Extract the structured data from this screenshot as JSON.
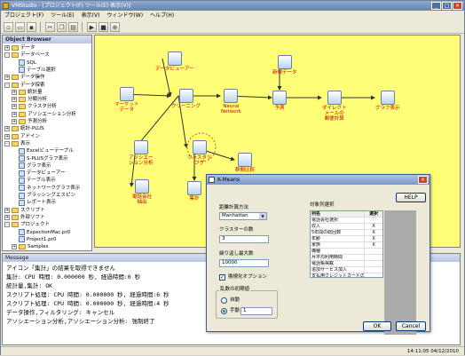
{
  "window": {
    "title": "VMStudio - [プロジェクト(F) ツール(E) 表示(V)]"
  },
  "menu": [
    "プロジェクト(F)",
    "ツール(E)",
    "表示(V)",
    "ウィンドウ(W)",
    "ヘルプ(H)"
  ],
  "toolbar": {
    "icons": [
      "new-icon",
      "open-icon",
      "save-icon",
      "cut-icon",
      "copy-icon",
      "paste-icon",
      "run-icon",
      "stop-icon",
      "zoom-icon"
    ]
  },
  "object_browser": {
    "title": "Object Browser",
    "items": [
      {
        "label": "データ",
        "level": 0,
        "expand": "+"
      },
      {
        "label": "データベース",
        "level": 0,
        "expand": "-"
      },
      {
        "label": "SQL",
        "level": 1,
        "expand": ""
      },
      {
        "label": "テーブル選択",
        "level": 1,
        "expand": ""
      },
      {
        "label": "データ操作",
        "level": 0,
        "expand": "+"
      },
      {
        "label": "データ探索",
        "level": 0,
        "expand": "-"
      },
      {
        "label": "統計量",
        "level": 1,
        "expand": "+"
      },
      {
        "label": "分類分析",
        "level": 1,
        "expand": "+"
      },
      {
        "label": "クラスタ分析",
        "level": 1,
        "expand": "+"
      },
      {
        "label": "アソシエーション分析",
        "level": 1,
        "expand": "+"
      },
      {
        "label": "予測分析",
        "level": 1,
        "expand": "+"
      },
      {
        "label": "統計-PLUS",
        "level": 0,
        "expand": "+"
      },
      {
        "label": "アドイン",
        "level": 0,
        "expand": "+"
      },
      {
        "label": "表示",
        "level": 0,
        "expand": "-"
      },
      {
        "label": "Excelビューテーブル",
        "level": 1,
        "expand": ""
      },
      {
        "label": "S-PLUSグラフ表示",
        "level": 1,
        "expand": ""
      },
      {
        "label": "グラフ表示",
        "level": 1,
        "expand": ""
      },
      {
        "label": "データビューアー",
        "level": 1,
        "expand": ""
      },
      {
        "label": "テーブル表示",
        "level": 1,
        "expand": ""
      },
      {
        "label": "ネットワークグラフ表示",
        "level": 1,
        "expand": ""
      },
      {
        "label": "ブラッシングエスピン",
        "level": 1,
        "expand": ""
      },
      {
        "label": "レポート表示",
        "level": 1,
        "expand": ""
      },
      {
        "label": "スクリプト",
        "level": 0,
        "expand": "+"
      },
      {
        "label": "外部ソフト",
        "level": 0,
        "expand": "+"
      },
      {
        "label": "プロジェクト",
        "level": 0,
        "expand": "-"
      },
      {
        "label": "ExpectionMac.pr0",
        "level": 1,
        "expand": ""
      },
      {
        "label": "Project1.pr0",
        "level": 1,
        "expand": ""
      },
      {
        "label": "Samples",
        "level": 1,
        "expand": "+"
      }
    ]
  },
  "canvas": {
    "background": "#ffff77",
    "label_color": "#c00000",
    "nodes": [
      {
        "id": "n-dataviewer",
        "label": "データビューアー"
      },
      {
        "id": "n-market",
        "label": "マーケット\nデータ"
      },
      {
        "id": "n-cleaning",
        "label": "クリーニング"
      },
      {
        "id": "n-neural",
        "label": "Neural\nNetwork"
      },
      {
        "id": "n-newdata",
        "label": "新規データ"
      },
      {
        "id": "n-predict",
        "label": "予測"
      },
      {
        "id": "n-direct",
        "label": "ダイレクト\nメールの\n郵便計算"
      },
      {
        "id": "n-graph",
        "label": "グラフ表示"
      },
      {
        "id": "n-assoc",
        "label": "アソシエー\nション分析"
      },
      {
        "id": "n-cluster",
        "label": "クラスタリ\nング"
      },
      {
        "id": "n-groupcmp",
        "label": "群間比較"
      },
      {
        "id": "n-phone",
        "label": "電話会社\n抽出"
      },
      {
        "id": "n-sum",
        "label": "集計"
      }
    ]
  },
  "messages": {
    "title": "Message",
    "lines": [
      "アイコン「集計」の結果を取得できません",
      "集計: CPU 時間: 0.000000 秒, 経過時間:0 秒",
      "統計量,集計: OK",
      "スクリプト処理: CPU 時間: 0.000000 秒, 経過時間:6 秒",
      "スクリプト処理: CPU 時間: 0.000000 秒, 経過時間:4 秒",
      "データ操作,フィルタリング: キャンセル",
      "アソシエーション分析,アソシエーション分析: 強制終了"
    ]
  },
  "status": {
    "text": "14:11:05  04/12/2010"
  },
  "dialog": {
    "title": "K-Means",
    "help_label": "HELP",
    "distance_label": "距離計算方法",
    "distance_value": "Manhattan",
    "clusters_label": "クラスターの数",
    "clusters_value": "3",
    "iterations_label": "繰り返し最大数",
    "iterations_value": "10000",
    "option_label": "換規化オプション",
    "option_checked": true,
    "init_group_label": "乱数の初期値",
    "auto_label": "自動",
    "manual_label": "手動",
    "manual_value": "1",
    "vars_label": "対象列選択",
    "vars_header": [
      "列名",
      "選択"
    ],
    "vars": [
      {
        "name": "電話会社選択",
        "sel": ""
      },
      {
        "name": "収入",
        "sel": "X"
      },
      {
        "name": "5年間の総回数",
        "sel": "X"
      },
      {
        "name": "年齢",
        "sel": "X"
      },
      {
        "name": "家族",
        "sel": "X"
      },
      {
        "name": "職種",
        "sel": ""
      },
      {
        "name": "月平均利用時間",
        "sel": ""
      },
      {
        "name": "電話帳掲載",
        "sel": ""
      },
      {
        "name": "追加サービス加入",
        "sel": ""
      },
      {
        "name": "支払用クレジットカードの有無",
        "sel": ""
      }
    ],
    "ok_label": "OK",
    "cancel_label": "Cancel"
  }
}
